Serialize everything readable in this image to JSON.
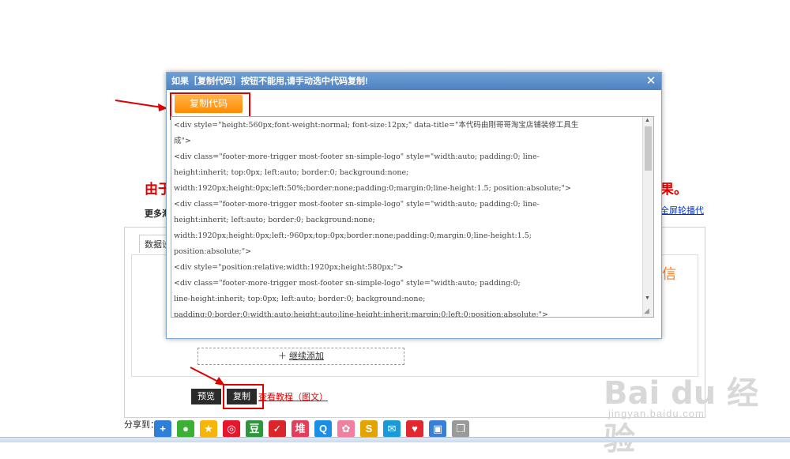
{
  "modal": {
    "title": "如果［复制代码］按钮不能用,请手动选中代码复制!",
    "copy_button": "复制代码",
    "code_lines": [
      "<div style=\"height:560px;font-weight:normal; font-size:12px;\" data-title=\"本代码由刚哥哥淘宝店铺装修工具生",
      "成\">",
      "    <div class=\"footer-more-trigger most-footer sn-simple-logo\" style=\"width:auto; padding:0; line-",
      "height:inherit; top:0px; left:auto; border:0; background:none;",
      "width:1920px;height:0px;left:50%;border:none;padding:0;margin:0;line-height:1.5; position:absolute;\">",
      "        <div class=\"footer-more-trigger most-footer sn-simple-logo\" style=\"width:auto; padding:0; line-",
      "height:inherit; left:auto; border:0; background:none;",
      "width:1920px;height:0px;left:-960px;top:0px;border:none;padding:0;margin:0;line-height:1.5;",
      "position:absolute;\">",
      "            <div style=\"position:relative;width:1920px;height:580px;\">",
      "                <div class=\"footer-more-trigger most-footer sn-simple-logo\" style=\"width:auto; padding:0;",
      "line-height:inherit; top:0px; left:auto; border:0; background:none;",
      "padding:0;border:0;width:auto;height:auto;line-height:inherit;margin:0;left:0;position:absolute;\">"
    ]
  },
  "page": {
    "banner_left": "由于",
    "banner_right": "果。",
    "more_label": "更多淘",
    "fullscreen_link": "全屏轮播代",
    "tab_label": "数据设",
    "orange_text": "信",
    "add_more": "继续添加",
    "preview_button": "预览",
    "copy_button": "复制",
    "tutorial_link": "查看教程（图文）",
    "share_label": "分享到："
  },
  "share_icons": [
    {
      "name": "plus-share-icon",
      "glyph": "+",
      "color": "#2f7fd8"
    },
    {
      "name": "wechat-icon",
      "glyph": "●",
      "color": "#3cb034"
    },
    {
      "name": "qzone-icon",
      "glyph": "★",
      "color": "#f5b50a"
    },
    {
      "name": "weibo-icon",
      "glyph": "◎",
      "color": "#e6162d"
    },
    {
      "name": "douban-icon",
      "glyph": "豆",
      "color": "#2e963d"
    },
    {
      "name": "youdao-icon",
      "glyph": "✓",
      "color": "#d9262b"
    },
    {
      "name": "duitang-icon",
      "glyph": "堆",
      "color": "#e33e5c"
    },
    {
      "name": "qq-icon",
      "glyph": "Q",
      "color": "#1b8fe8"
    },
    {
      "name": "flower-icon",
      "glyph": "✿",
      "color": "#f07fa0"
    },
    {
      "name": "sohu-icon",
      "glyph": "S",
      "color": "#e3a400"
    },
    {
      "name": "message-icon",
      "glyph": "✉",
      "color": "#1a9ad6"
    },
    {
      "name": "heart-icon",
      "glyph": "♥",
      "color": "#e0282e"
    },
    {
      "name": "picture-icon",
      "glyph": "▣",
      "color": "#3a7fd6"
    },
    {
      "name": "copy-pages-icon",
      "glyph": "❐",
      "color": "#9a9a9a"
    }
  ],
  "watermark": {
    "big": "Bai du 经验",
    "small": "jingyan.baidu.com"
  },
  "colors": {
    "accent_red": "#e00000",
    "modal_title": "#4f82c0",
    "copy_orange": "#ff8a00"
  }
}
